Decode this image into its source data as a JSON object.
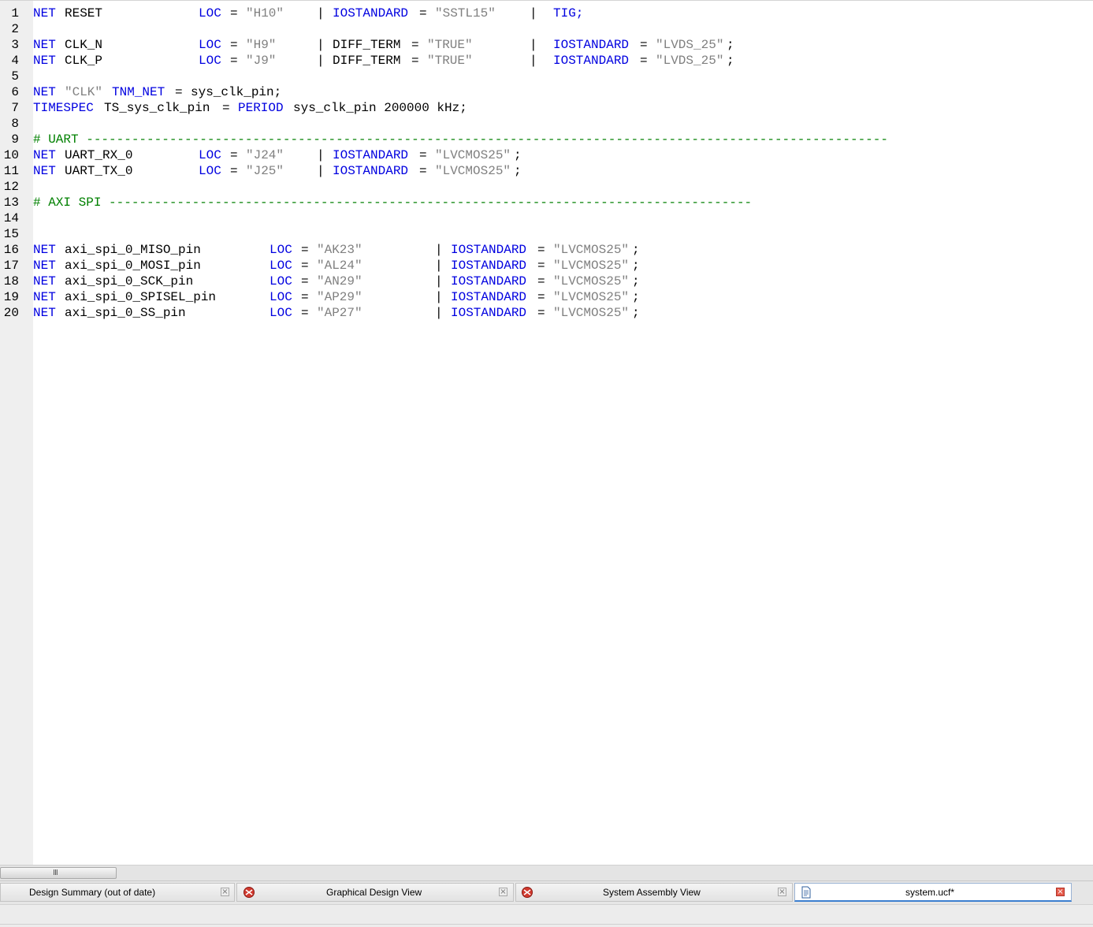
{
  "editor": {
    "lines": [
      {
        "n": "1",
        "segs": [
          [
            "NET",
            "kw",
            0
          ],
          [
            "RESET",
            "pl",
            4
          ],
          [
            "LOC",
            "kw",
            21
          ],
          [
            "=",
            "pl",
            25
          ],
          [
            "\"H10\"",
            "str",
            27
          ],
          [
            "|",
            "pl",
            36
          ],
          [
            "IOSTANDARD",
            "kw",
            38
          ],
          [
            "=",
            "pl",
            49
          ],
          [
            "\"SSTL15\"",
            "str",
            51
          ],
          [
            "|",
            "pl",
            63
          ],
          [
            "TIG;",
            "kw",
            66
          ]
        ]
      },
      {
        "n": "2",
        "segs": []
      },
      {
        "n": "3",
        "segs": [
          [
            "NET",
            "kw",
            0
          ],
          [
            "CLK_N",
            "pl",
            4
          ],
          [
            "LOC",
            "kw",
            21
          ],
          [
            "=",
            "pl",
            25
          ],
          [
            "\"H9\"",
            "str",
            27
          ],
          [
            "|",
            "pl",
            36
          ],
          [
            "DIFF_TERM",
            "pl",
            38
          ],
          [
            "=",
            "pl",
            48
          ],
          [
            "\"TRUE\"",
            "str",
            50
          ],
          [
            "|",
            "pl",
            63
          ],
          [
            "IOSTANDARD",
            "kw",
            66
          ],
          [
            "=",
            "pl",
            77
          ],
          [
            "\"LVDS_25\"",
            "str",
            79
          ],
          [
            ";",
            "pl",
            88
          ]
        ]
      },
      {
        "n": "4",
        "segs": [
          [
            "NET",
            "kw",
            0
          ],
          [
            "CLK_P",
            "pl",
            4
          ],
          [
            "LOC",
            "kw",
            21
          ],
          [
            "=",
            "pl",
            25
          ],
          [
            "\"J9\"",
            "str",
            27
          ],
          [
            "|",
            "pl",
            36
          ],
          [
            "DIFF_TERM",
            "pl",
            38
          ],
          [
            "=",
            "pl",
            48
          ],
          [
            "\"TRUE\"",
            "str",
            50
          ],
          [
            "|",
            "pl",
            63
          ],
          [
            "IOSTANDARD",
            "kw",
            66
          ],
          [
            "=",
            "pl",
            77
          ],
          [
            "\"LVDS_25\"",
            "str",
            79
          ],
          [
            ";",
            "pl",
            88
          ]
        ]
      },
      {
        "n": "5",
        "segs": []
      },
      {
        "n": "6",
        "segs": [
          [
            "NET",
            "kw",
            0
          ],
          [
            "\"CLK\"",
            "str",
            4
          ],
          [
            "TNM_NET",
            "kw",
            10
          ],
          [
            "=",
            "pl",
            18
          ],
          [
            "sys_clk_pin;",
            "pl",
            20
          ]
        ]
      },
      {
        "n": "7",
        "segs": [
          [
            "TIMESPEC",
            "kw",
            0
          ],
          [
            "TS_sys_clk_pin",
            "pl",
            9
          ],
          [
            "=",
            "pl",
            24
          ],
          [
            "PERIOD",
            "kw",
            26
          ],
          [
            "sys_clk_pin 200000 kHz;",
            "pl",
            33
          ]
        ]
      },
      {
        "n": "8",
        "segs": []
      },
      {
        "n": "9",
        "segs": [
          [
            "# UART ----------------------------------------------------------------------------------------------------------",
            "cm",
            0
          ]
        ]
      },
      {
        "n": "10",
        "segs": [
          [
            "NET",
            "kw",
            0
          ],
          [
            "UART_RX_0",
            "pl",
            4
          ],
          [
            "LOC",
            "kw",
            21
          ],
          [
            "=",
            "pl",
            25
          ],
          [
            "\"J24\"",
            "str",
            27
          ],
          [
            "|",
            "pl",
            36
          ],
          [
            "IOSTANDARD",
            "kw",
            38
          ],
          [
            "=",
            "pl",
            49
          ],
          [
            "\"LVCMOS25\"",
            "str",
            51
          ],
          [
            ";",
            "pl",
            61
          ]
        ]
      },
      {
        "n": "11",
        "segs": [
          [
            "NET",
            "kw",
            0
          ],
          [
            "UART_TX_0",
            "pl",
            4
          ],
          [
            "LOC",
            "kw",
            21
          ],
          [
            "=",
            "pl",
            25
          ],
          [
            "\"J25\"",
            "str",
            27
          ],
          [
            "|",
            "pl",
            36
          ],
          [
            "IOSTANDARD",
            "kw",
            38
          ],
          [
            "=",
            "pl",
            49
          ],
          [
            "\"LVCMOS25\"",
            "str",
            51
          ],
          [
            ";",
            "pl",
            61
          ]
        ]
      },
      {
        "n": "12",
        "segs": []
      },
      {
        "n": "13",
        "segs": [
          [
            "# AXI SPI -------------------------------------------------------------------------------------",
            "cm",
            0
          ]
        ]
      },
      {
        "n": "14",
        "segs": []
      },
      {
        "n": "15",
        "segs": []
      },
      {
        "n": "16",
        "segs": [
          [
            "NET",
            "kw",
            0
          ],
          [
            "axi_spi_0_MISO_pin",
            "pl",
            4
          ],
          [
            "LOC",
            "kw",
            30
          ],
          [
            "=",
            "pl",
            34
          ],
          [
            "\"AK23\"",
            "str",
            36
          ],
          [
            "|",
            "pl",
            51
          ],
          [
            "IOSTANDARD",
            "kw",
            53
          ],
          [
            "=",
            "pl",
            64
          ],
          [
            "\"LVCMOS25\"",
            "str",
            66
          ],
          [
            ";",
            "pl",
            76
          ]
        ]
      },
      {
        "n": "17",
        "segs": [
          [
            "NET",
            "kw",
            0
          ],
          [
            "axi_spi_0_MOSI_pin",
            "pl",
            4
          ],
          [
            "LOC",
            "kw",
            30
          ],
          [
            "=",
            "pl",
            34
          ],
          [
            "\"AL24\"",
            "str",
            36
          ],
          [
            "|",
            "pl",
            51
          ],
          [
            "IOSTANDARD",
            "kw",
            53
          ],
          [
            "=",
            "pl",
            64
          ],
          [
            "\"LVCMOS25\"",
            "str",
            66
          ],
          [
            ";",
            "pl",
            76
          ]
        ]
      },
      {
        "n": "18",
        "segs": [
          [
            "NET",
            "kw",
            0
          ],
          [
            "axi_spi_0_SCK_pin",
            "pl",
            4
          ],
          [
            "LOC",
            "kw",
            30
          ],
          [
            "=",
            "pl",
            34
          ],
          [
            "\"AN29\"",
            "str",
            36
          ],
          [
            "|",
            "pl",
            51
          ],
          [
            "IOSTANDARD",
            "kw",
            53
          ],
          [
            "=",
            "pl",
            64
          ],
          [
            "\"LVCMOS25\"",
            "str",
            66
          ],
          [
            ";",
            "pl",
            76
          ]
        ]
      },
      {
        "n": "19",
        "segs": [
          [
            "NET",
            "kw",
            0
          ],
          [
            "axi_spi_0_SPISEL_pin",
            "pl",
            4
          ],
          [
            "LOC",
            "kw",
            30
          ],
          [
            "=",
            "pl",
            34
          ],
          [
            "\"AP29\"",
            "str",
            36
          ],
          [
            "|",
            "pl",
            51
          ],
          [
            "IOSTANDARD",
            "kw",
            53
          ],
          [
            "=",
            "pl",
            64
          ],
          [
            "\"LVCMOS25\"",
            "str",
            66
          ],
          [
            ";",
            "pl",
            76
          ]
        ]
      },
      {
        "n": "20",
        "segs": [
          [
            "NET",
            "kw",
            0
          ],
          [
            "axi_spi_0_SS_pin",
            "pl",
            4
          ],
          [
            "LOC",
            "kw",
            30
          ],
          [
            "=",
            "pl",
            34
          ],
          [
            "\"AP27\"",
            "str",
            36
          ],
          [
            "|",
            "pl",
            51
          ],
          [
            "IOSTANDARD",
            "kw",
            53
          ],
          [
            "=",
            "pl",
            64
          ],
          [
            "\"LVCMOS25\"",
            "str",
            66
          ],
          [
            ";",
            "pl",
            76
          ]
        ]
      }
    ]
  },
  "scrollbar": {
    "grip": "III"
  },
  "tabs": {
    "design_summary": {
      "label": "Design Summary (out of date)",
      "close": "×"
    },
    "graphical_design_view": {
      "label": "Graphical Design View",
      "icon": "xps-icon",
      "close": "×"
    },
    "system_assembly_view": {
      "label": "System Assembly View",
      "icon": "xps-icon",
      "close": "×"
    },
    "system_ucf": {
      "label": "system.ucf*",
      "icon": "document-icon",
      "close": "×",
      "active": true
    }
  },
  "colors": {
    "keyword": "#0000e0",
    "string": "#808080",
    "comment": "#008000",
    "text": "#000000",
    "gutter": "#efefef"
  }
}
